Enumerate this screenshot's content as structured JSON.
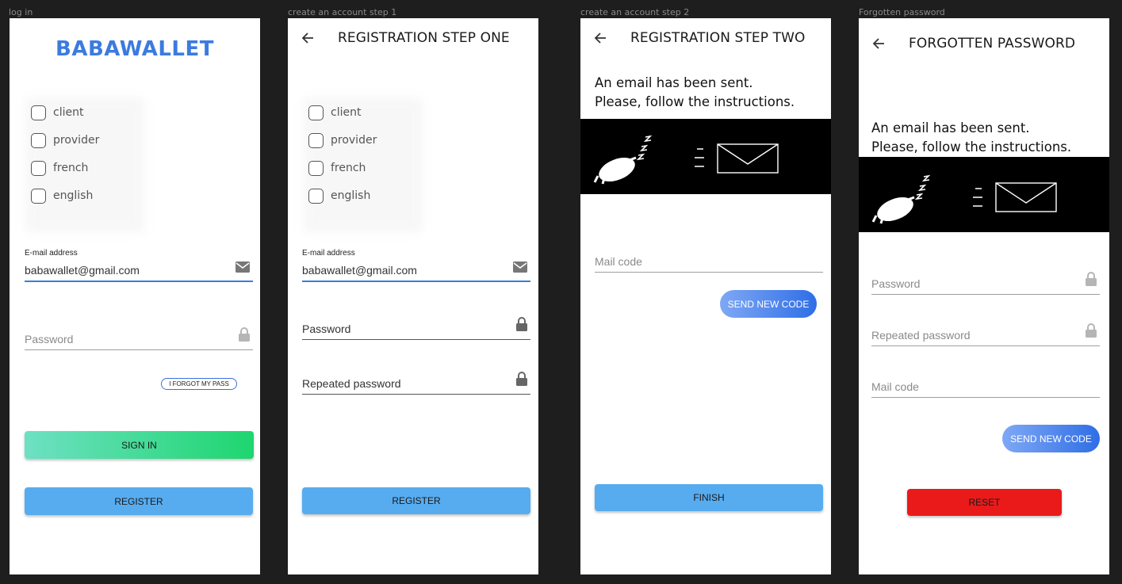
{
  "frames": {
    "login": "log in",
    "register1": "create an account step 1",
    "register2": "create an account step 2",
    "forgot": "Forgotten password"
  },
  "login": {
    "logo": "BABAWALLET",
    "options": [
      "client",
      "provider",
      "french",
      "english"
    ],
    "email_label": "E-mail address",
    "email_value": "babawallet@gmail.com",
    "password_placeholder": "Password",
    "forgot_label": "I FORGOT MY PASS",
    "signin_label": "SIGN IN",
    "register_label": "REGISTER"
  },
  "register1": {
    "title": "REGISTRATION STEP ONE",
    "options": [
      "client",
      "provider",
      "french",
      "english"
    ],
    "email_label": "E-mail address",
    "email_value": "babawallet@gmail.com",
    "password_placeholder": "Password",
    "repeated_placeholder": "Repeated password",
    "register_label": "REGISTER"
  },
  "register2": {
    "title": "REGISTRATION STEP TWO",
    "message_line1": "An email has been sent.",
    "message_line2": "Please, follow the instructions.",
    "mailcode_placeholder": "Mail code",
    "send_code_label": "SEND NEW CODE",
    "finish_label": "FINISH"
  },
  "forgot": {
    "title": "FORGOTTEN PASSWORD",
    "message_line1": "An email has been sent.",
    "message_line2": "Please, follow the instructions.",
    "password_placeholder": "Password",
    "repeated_placeholder": "Repeated password",
    "mailcode_placeholder": "Mail code",
    "send_code_label": "SEND NEW CODE",
    "reset_label": "RESET"
  },
  "icons": {
    "back": "arrow-left-icon",
    "mail": "mail-icon",
    "lock": "lock-icon",
    "sleeping": "sleeping-creature-icon",
    "envelope": "envelope-icon"
  },
  "colors": {
    "brand_blue": "#3b7be0",
    "button_blue": "#57acf0",
    "button_green": "#1ed66f",
    "button_red": "#ea1a1a",
    "background": "#1e1e1e"
  }
}
